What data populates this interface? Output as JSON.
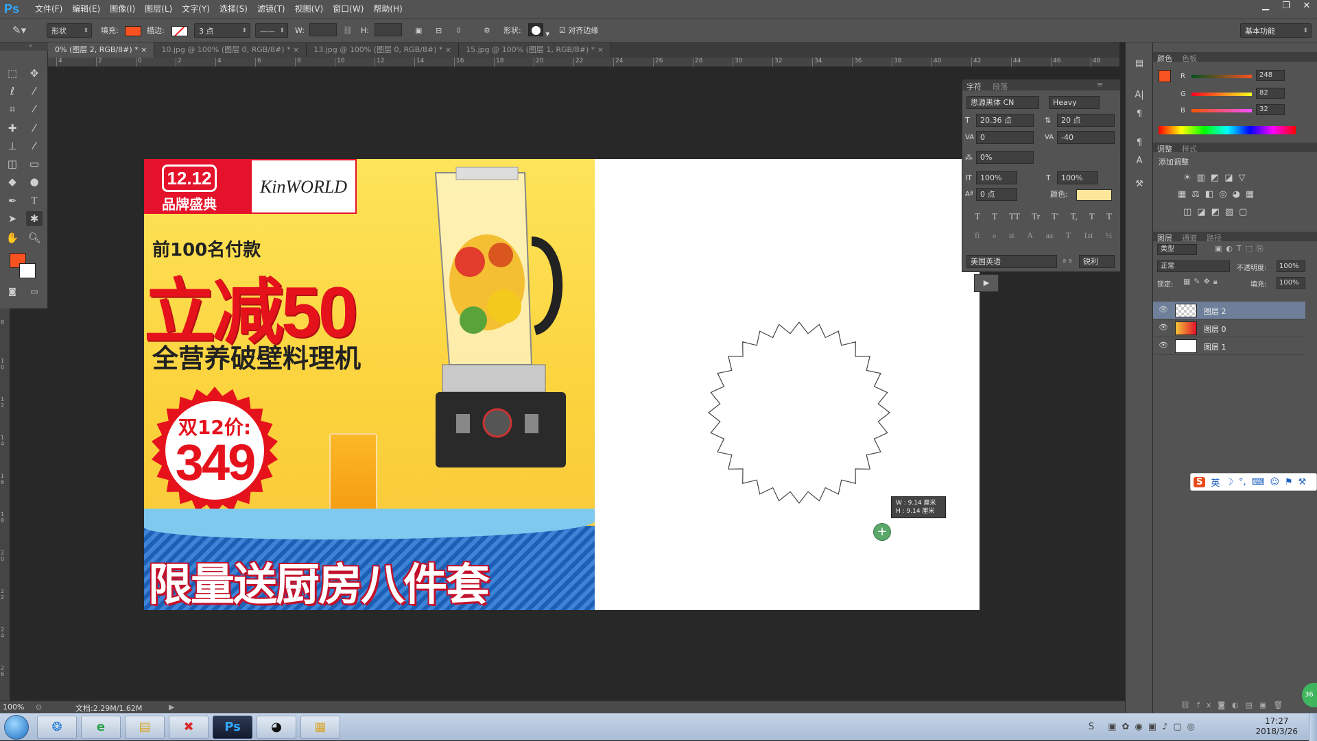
{
  "app": {
    "logo": "Ps"
  },
  "menu": [
    "文件(F)",
    "编辑(E)",
    "图像(I)",
    "图层(L)",
    "文字(Y)",
    "选择(S)",
    "滤镜(T)",
    "视图(V)",
    "窗口(W)",
    "帮助(H)"
  ],
  "options": {
    "mode": "形状",
    "fill_label": "填充:",
    "fill_color": "#f85220",
    "stroke_label": "描边:",
    "stroke_width": "3 点",
    "w_label": "W:",
    "h_label": "H:",
    "shape_label": "形状:",
    "align_edges": "对齐边缘",
    "workspace": "基本功能"
  },
  "tabs": [
    {
      "label": "0% (图层 2, RGB/8#) *",
      "active": true
    },
    {
      "label": "10.jpg @ 100% (图层 0, RGB/8#) *",
      "active": false
    },
    {
      "label": "13.jpg @ 100% (图层 0, RGB/8#) *",
      "active": false
    },
    {
      "label": "15.jpg @ 100% (图层 1, RGB/8#) *",
      "active": false
    }
  ],
  "ruler_top": [
    "4",
    "2",
    "0",
    "2",
    "4",
    "6",
    "8",
    "10",
    "12",
    "14",
    "16",
    "18",
    "20",
    "22",
    "24",
    "26",
    "28",
    "30",
    "32",
    "34",
    "36",
    "38",
    "40",
    "42",
    "44",
    "46",
    "48"
  ],
  "ruler_left": [
    "8",
    "1 0",
    "1 2",
    "1 4",
    "1 6",
    "1 8",
    "2 0",
    "2 2",
    "2 4",
    "2 6"
  ],
  "banner": {
    "badge_top": "12.12",
    "badge_bottom": "品牌盛典",
    "brand": "KinWORLD",
    "line1": "前100名付款",
    "headline": "立减50",
    "subtitle": "全营养破壁料理机",
    "price_label": "双12价:",
    "price": "349",
    "footer": "限量送厨房八件套"
  },
  "size_tooltip": {
    "w": "W : 9.14 厘米",
    "h": "H : 9.14 厘米"
  },
  "character_panel": {
    "tab_active": "字符",
    "tab_other": "段落",
    "font_family": "思源黑体 CN",
    "font_style": "Heavy",
    "font_size": "20.36 点",
    "leading": "20 点",
    "kerning": "0",
    "tracking": "-40",
    "tsume": "0%",
    "vertical_scale": "100%",
    "horizontal_scale": "100%",
    "baseline": "0 点",
    "color_label": "颜色:",
    "text_color": "#fde59a",
    "language": "美国英语",
    "aa_label": "a a",
    "antialias": "锐利",
    "style_buttons": [
      "T",
      "T",
      "TT",
      "Tr",
      "T'",
      "T,",
      "T",
      "T"
    ],
    "opentype_buttons": [
      "fi",
      "ℴ",
      "st",
      "A",
      "aa",
      "T",
      "1st",
      "½"
    ]
  },
  "color_panel": {
    "tab_active": "颜色",
    "tab_other": "色板",
    "r_label": "R",
    "g_label": "G",
    "b_label": "B",
    "r": "248",
    "g": "82",
    "b": "32",
    "foreground": "#f85220"
  },
  "adjust_panel": {
    "tab_active": "调整",
    "tab_other": "样式",
    "title": "添加调整"
  },
  "layers_panel": {
    "tabs": [
      "图层",
      "通道",
      "路径"
    ],
    "filter": "类型",
    "blend": "正常",
    "opacity_label": "不透明度:",
    "opacity": "100%",
    "lock_label": "锁定:",
    "fill_label": "填充:",
    "fill": "100%",
    "layers": [
      {
        "name": "图层 2",
        "selected": true
      },
      {
        "name": "图层 0",
        "selected": false
      },
      {
        "name": "图层 1",
        "selected": false
      }
    ]
  },
  "ime_bar": {
    "lang": "英"
  },
  "status": {
    "zoom": "100%",
    "doc": "文档:2.29M/1.62M"
  },
  "taskbar": {
    "time": "17:27",
    "date": "2018/3/26",
    "apps": [
      "start",
      "baidu",
      "ie",
      "explorer",
      "wps",
      "photoshop",
      "qq",
      "notepad"
    ]
  }
}
